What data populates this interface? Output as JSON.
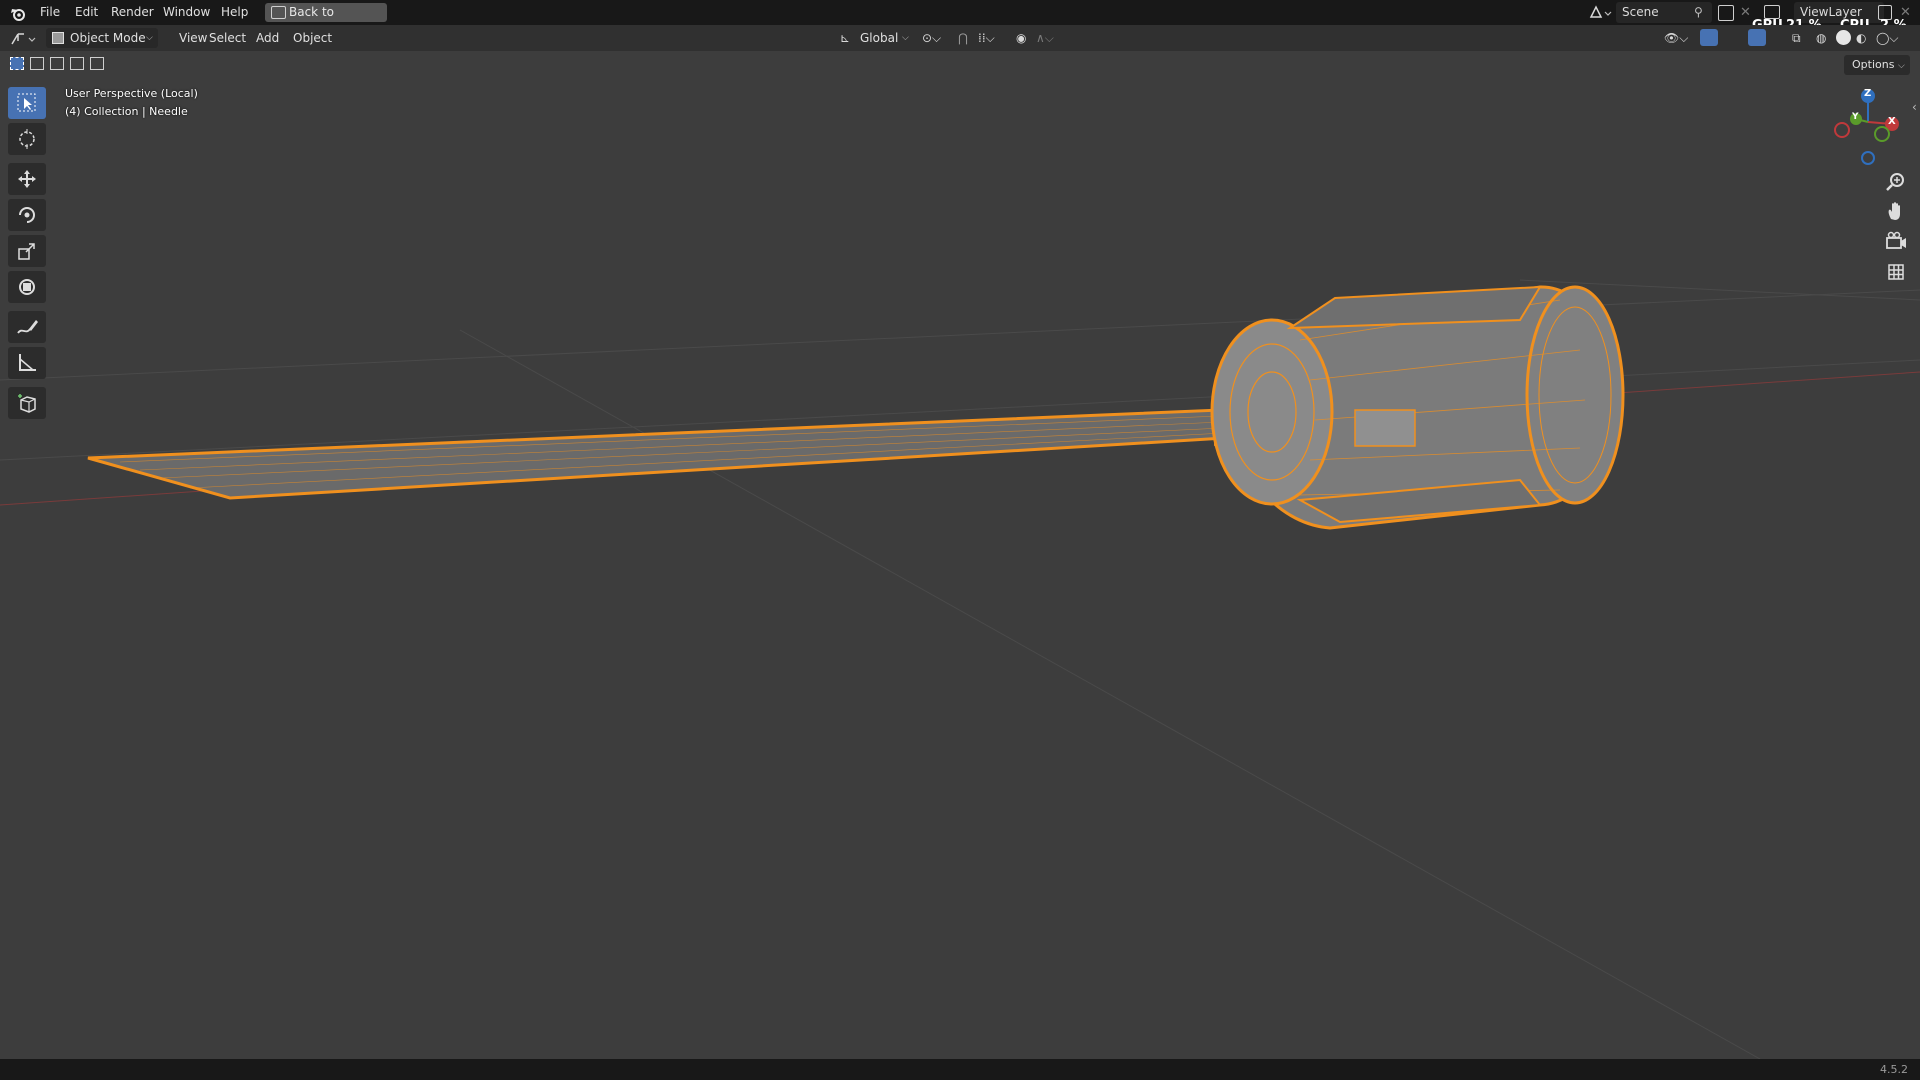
{
  "app": {
    "menus": [
      "File",
      "Edit",
      "Render",
      "Window",
      "Help"
    ],
    "back_button": "Back to Previous",
    "scene": "Scene",
    "view_layer": "ViewLayer",
    "gpu_label": "GPU",
    "gpu_value": "21 %",
    "cpu_label": "CPU",
    "cpu_value": "2 %",
    "version": "4.5.2"
  },
  "header": {
    "mode": "Object Mode",
    "menus": [
      "View",
      "Select",
      "Add",
      "Object"
    ],
    "orientation": "Global",
    "options": "Options"
  },
  "viewport": {
    "perspective": "User Perspective (Local)",
    "collection": "(4) Collection | Needle",
    "background_color": "#3d3d3d",
    "selection_color": "#f0901e"
  },
  "gizmo": {
    "z": "Z",
    "y": "Y",
    "x": "X"
  },
  "tools": [
    {
      "name": "select-box",
      "active": true
    },
    {
      "name": "cursor",
      "active": false
    },
    {
      "name": "move",
      "active": false
    },
    {
      "name": "rotate",
      "active": false
    },
    {
      "name": "scale",
      "active": false
    },
    {
      "name": "transform",
      "active": false
    },
    {
      "name": "annotate",
      "active": false
    },
    {
      "name": "measure",
      "active": false
    },
    {
      "name": "add-cube",
      "active": false
    }
  ]
}
